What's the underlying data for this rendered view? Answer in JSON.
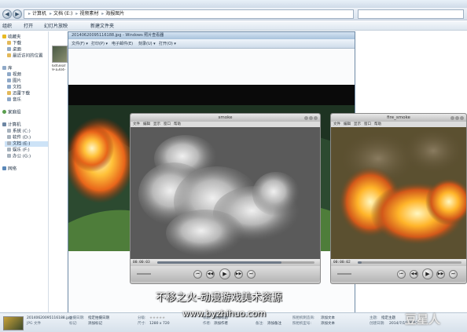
{
  "explorer": {
    "nav_back": "◀",
    "nav_forward": "▶",
    "path": [
      "计算机",
      "文档 (E:)",
      "视频素材",
      "海报图片"
    ],
    "toolbar": [
      "组织",
      "打开",
      "幻灯片放映",
      "新建文件夹"
    ],
    "nav": {
      "favorites": "收藏夹",
      "downloads": "下载",
      "desktop": "桌面",
      "recent": "最近访问的位置",
      "libraries": "库",
      "videos": "视频",
      "pictures": "图片",
      "documents": "文档",
      "thunder": "迅雷下载",
      "music": "音乐",
      "homegroup": "家庭组",
      "computer": "计算机",
      "drive_c": "系统 (C:)",
      "drive_d": "软件 (D:)",
      "drive_e": "文档 (E:)",
      "drive_f": "娱乐 (F:)",
      "drive_g": "办公 (G:)",
      "network": "网络"
    },
    "file_thumb_name": [
      "6df3eaf",
      "9-a304-"
    ]
  },
  "viewer": {
    "title": "20140620095116188.jpg - Windows 照片查看器",
    "menu": [
      "文件(F) ▾",
      "打印(P) ▾",
      "电子邮件(E)",
      "刻录(U) ▾",
      "打开(O) ▾"
    ]
  },
  "smoke_player": {
    "title": "smoke",
    "menu": [
      "文件",
      "编辑",
      "显示",
      "窗口",
      "帮助"
    ],
    "timecode": "00:00:03",
    "progress_fraction": 0.79
  },
  "fire_player": {
    "title": "fire_smoke",
    "menu": [
      "文件",
      "编辑",
      "显示",
      "窗口",
      "帮助"
    ],
    "timecode": "00:00:02",
    "progress_fraction": 0.04
  },
  "details": {
    "filename": "20140620095116188.jpg",
    "filetype": "JPG 文件",
    "date_taken_label": "拍摄日期:",
    "date_taken_value": "指定拍摄日期",
    "tags_label": "标记:",
    "tags_value": "添加标记",
    "rating_label": "分级:",
    "size_label": "尺寸:",
    "size_value": "1280 x 720",
    "title_label": "标题:",
    "title_value": "添加标题",
    "authors_label": "作者:",
    "authors_value": "添加作者",
    "comments_label": "备注:",
    "comments_value": "添加备注",
    "camera_maker_label": "照相机制造商:",
    "camera_maker_value": "添加文本",
    "camera_model_label": "照相机型号:",
    "camera_model_value": "添加文本",
    "subject_label": "主题:",
    "subject_value": "指定主题",
    "created_label": "创建日期:",
    "created_value": "2014/7/15 星期二 下午"
  },
  "watermarks": {
    "subtitle": "不移之火-动漫游戏美术资源",
    "url": "www.byzhihuo.com",
    "brand": "豆星人"
  },
  "colors": {
    "explorer_bg": "#ffffff",
    "chrome": "#d9e3ee",
    "qt_chrome": "#c8c8c8",
    "smoke_bg": "#5e5e5e",
    "fire_bg": "#6a5a30"
  }
}
